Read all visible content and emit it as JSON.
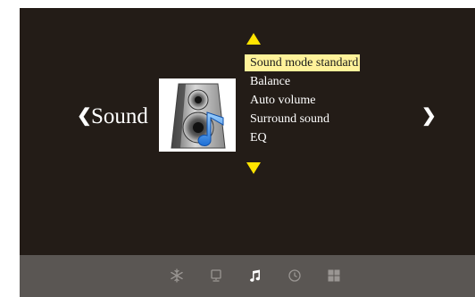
{
  "menu": {
    "category": "Sound",
    "items": [
      {
        "label": "Sound mode standard",
        "selected": true
      },
      {
        "label": "Balance",
        "selected": false
      },
      {
        "label": "Auto volume",
        "selected": false
      },
      {
        "label": "Surround sound",
        "selected": false
      },
      {
        "label": "EQ",
        "selected": false
      }
    ]
  },
  "navigation": {
    "left_arrow": "❮",
    "right_arrow": "❯"
  },
  "tabs": [
    {
      "icon": "snowflake-icon",
      "name": "settings",
      "active": false
    },
    {
      "icon": "monitor-icon",
      "name": "picture",
      "active": false
    },
    {
      "icon": "music-note-icon",
      "name": "sound",
      "active": true
    },
    {
      "icon": "clock-icon",
      "name": "time",
      "active": false
    },
    {
      "icon": "grid-icon",
      "name": "apps",
      "active": false
    }
  ],
  "colors": {
    "panel_background": "#231c17",
    "bottom_bar": "#5a5653",
    "highlight": "#fff29a",
    "arrow_accent": "#ffe400",
    "tab_inactive": "#9a9693",
    "tab_active": "#ffffff"
  }
}
